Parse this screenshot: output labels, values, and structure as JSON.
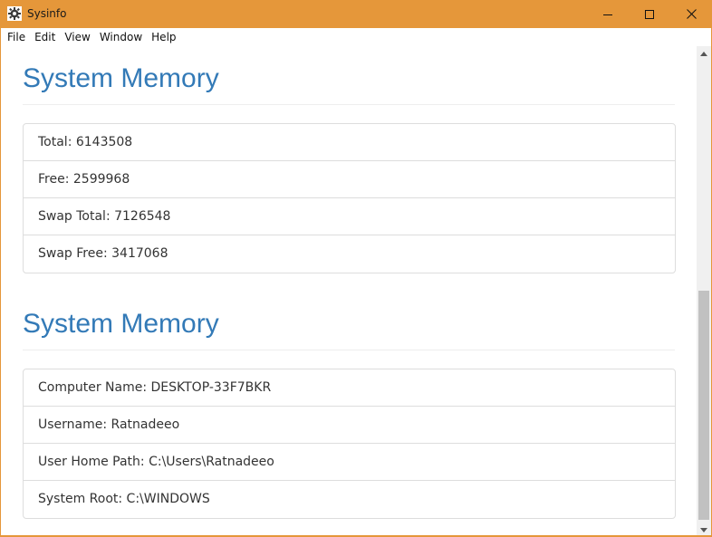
{
  "window": {
    "title": "Sysinfo",
    "icon": "gear-icon",
    "accent_color": "#e5973a"
  },
  "menu": [
    "File",
    "Edit",
    "View",
    "Window",
    "Help"
  ],
  "sections": [
    {
      "title": "System Memory",
      "items": [
        "Total: 6143508",
        "Free: 2599968",
        "Swap Total: 7126548",
        "Swap Free: 3417068"
      ]
    },
    {
      "title": "System Memory",
      "items": [
        "Computer Name: DESKTOP-33F7BKR",
        "Username: Ratnadeeo",
        "User Home Path: C:\\Users\\Ratnadeeo",
        "System Root: C:\\WINDOWS"
      ]
    }
  ],
  "colors": {
    "heading": "#337ab7",
    "text": "#333333",
    "border": "#dddddd"
  }
}
